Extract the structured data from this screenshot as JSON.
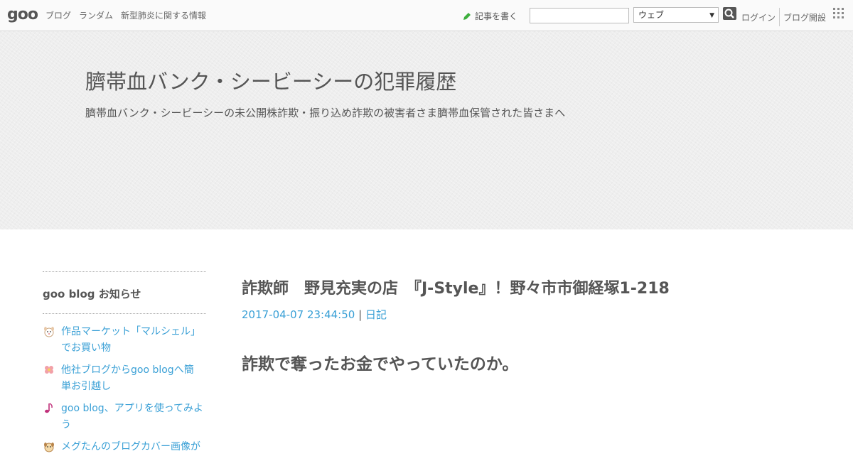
{
  "topbar": {
    "logo": "goo",
    "nav": [
      "ブログ",
      "ランダム",
      "新型肺炎に関する情報"
    ],
    "write_label": "記事を書く",
    "search_value": "",
    "search_scope": "ウェブ",
    "login_label": "ログイン",
    "open_blog_label": "ブログ開設"
  },
  "header": {
    "title": "臍帯血バンク・シービーシーの犯罪履歴",
    "description": "臍帯血バンク・シービーシーの未公開株詐欺・振り込め詐欺の被害者さま臍帯血保管された皆さまへ"
  },
  "sidebar": {
    "heading": "goo blog お知らせ",
    "items": [
      {
        "label": "作品マーケット「マルシェル」でお買い物",
        "icon": "dog-face-icon"
      },
      {
        "label": "他社ブログからgoo blogへ簡単お引越し",
        "icon": "flower-icon"
      },
      {
        "label": "goo blog、アプリを使ってみよう",
        "icon": "music-note-icon"
      },
      {
        "label": "メグたんのブログカバー画像が",
        "icon": "dog-face-icon"
      }
    ]
  },
  "post": {
    "title": "詐欺師　野見充実の店　『J-Style』！野々市市御経塚1-218",
    "date": "2017-04-07 23:44:50",
    "separator": "|",
    "category": "日記",
    "body": "詐欺で奪ったお金でやっていたのか。"
  },
  "colors": {
    "accent_link": "#3aa0d6",
    "text": "#555555",
    "logo_red": "#e60012",
    "pencil_green": "#3cae3c"
  }
}
